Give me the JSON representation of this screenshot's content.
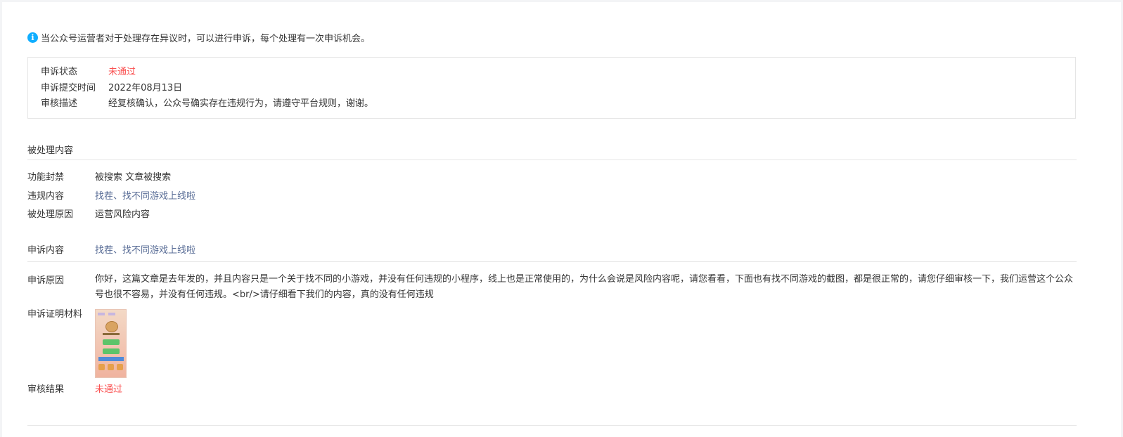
{
  "notice": {
    "icon": "info-icon",
    "text": "当公众号运营者对于处理存在异议时，可以进行申诉，每个处理有一次申诉机会。"
  },
  "status": {
    "state_label": "申诉状态",
    "state_value": "未通过",
    "time_label": "申诉提交时间",
    "time_value": "2022年08月13日",
    "desc_label": "审核描述",
    "desc_value": "经复核确认，公众号确实存在违规行为，请遵守平台规则，谢谢。"
  },
  "processed": {
    "title": "被处理内容",
    "ban_label": "功能封禁",
    "ban_value": "被搜索 文章被搜索",
    "violation_label": "违规内容",
    "violation_value": "找茬、找不同游戏上线啦",
    "reason_label": "被处理原因",
    "reason_value": "运营风险内容"
  },
  "appeal": {
    "content_label": "申诉内容",
    "content_value": "找茬、找不同游戏上线啦",
    "reason_label": "申诉原因",
    "reason_value": "你好，这篇文章是去年发的，并且内容只是一个关于找不同的小游戏，并没有任何违规的小程序，线上也是正常使用的，为什么会说是风险内容呢，请您看看，下面也有找不同游戏的截图，都是很正常的，请您仔细审核一下，我们运营这个公众号也很不容易，并没有任何违规。<br/>请仔细看下我们的内容，真的没有任何违规",
    "proof_label": "申诉证明材料",
    "result_label": "审核结果",
    "result_value": "未通过"
  },
  "colors": {
    "red": "#fa5151",
    "link": "#576b95",
    "info": "#10aeff"
  }
}
